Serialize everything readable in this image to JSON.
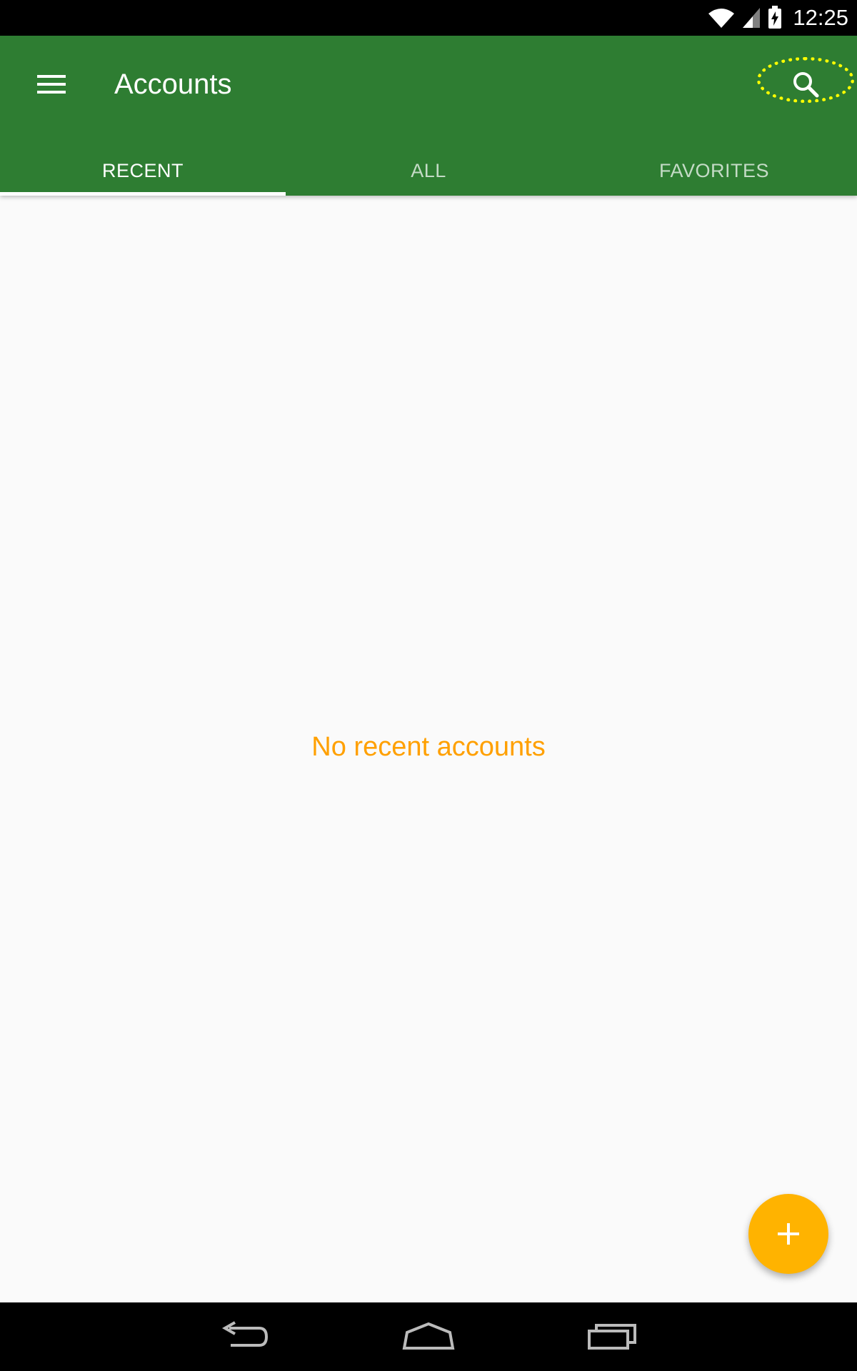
{
  "status_bar": {
    "time": "12:25",
    "icons": [
      "wifi-icon",
      "cell-signal-icon",
      "battery-charging-icon"
    ]
  },
  "app_bar": {
    "title": "Accounts",
    "menu_icon": "hamburger-menu-icon",
    "search_icon": "search-icon",
    "color": "#2e7d32"
  },
  "tabs": [
    {
      "label": "RECENT",
      "active": true
    },
    {
      "label": "ALL",
      "active": false
    },
    {
      "label": "FAVORITES",
      "active": false
    }
  ],
  "main": {
    "empty_message": "No recent accounts",
    "empty_color": "#ffa000"
  },
  "fab": {
    "icon": "plus-icon",
    "color": "#ffb300"
  },
  "nav_bar": {
    "buttons": [
      "back-icon",
      "home-icon",
      "recent-apps-icon"
    ]
  }
}
